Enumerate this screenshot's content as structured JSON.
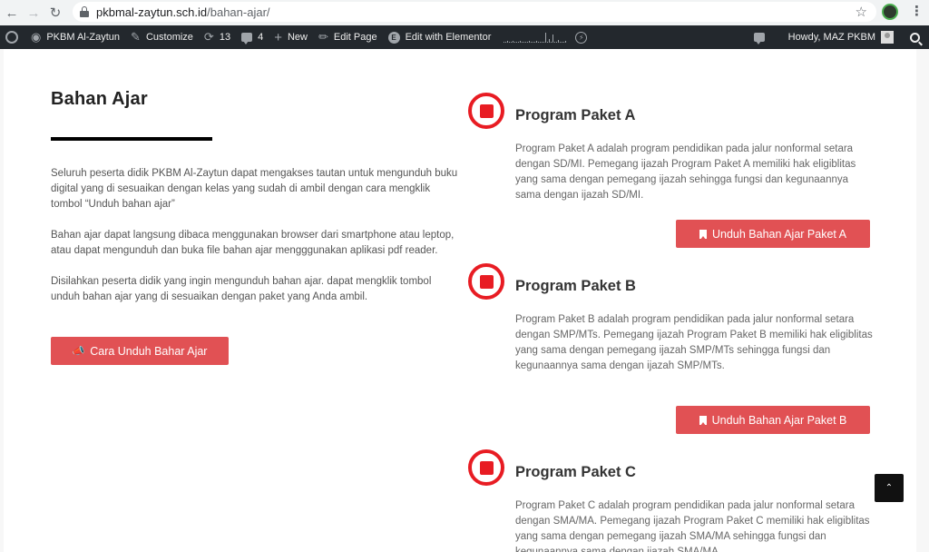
{
  "browser": {
    "url_host": "pkbmal-zaytun.sch.id",
    "url_path": "/bahan-ajar/"
  },
  "adminbar": {
    "site_name": "PKBM Al-Zaytun",
    "customize": "Customize",
    "updates_count": "13",
    "comments_count": "4",
    "new_label": "New",
    "edit_page": "Edit Page",
    "edit_elementor": "Edit with Elementor",
    "howdy": "Howdy, MAZ PKBM"
  },
  "left": {
    "title": "Bahan Ajar",
    "paragraphs": [
      "Seluruh peserta didik PKBM Al-Zaytun dapat mengakses tautan untuk mengunduh buku digital yang di sesuaikan dengan kelas yang sudah di ambil dengan cara mengklik tombol “Unduh bahan ajar”",
      "Bahan ajar dapat langsung dibaca menggunakan browser dari smartphone atau leptop, atau dapat mengunduh dan buka file bahan ajar mengggunakan aplikasi pdf reader.",
      "Disilahkan peserta didik yang ingin mengunduh bahan ajar. dapat mengklik tombol unduh bahan ajar yang di sesuaikan dengan paket yang Anda ambil."
    ],
    "button": "Cara Unduh Bahar Ajar"
  },
  "programs": [
    {
      "title": "Program Paket A",
      "desc": "Program Paket A adalah program pendidikan pada jalur nonformal setara dengan SD/MI. Pemegang ijazah Program Paket A memiliki hak eligiblitas yang sama dengan pemegang ijazah sehingga fungsi dan kegunaannya sama dengan ijazah SD/MI.",
      "button": "Unduh Bahan Ajar Paket A"
    },
    {
      "title": "Program Paket B",
      "desc": "Program Paket B adalah program pendidikan pada jalur nonformal setara dengan SMP/MTs. Pemegang ijazah Program Paket B memiliki hak eligiblitas yang sama dengan pemegang ijazah SMP/MTs sehingga fungsi dan kegunaannya sama dengan ijazah SMP/MTs.",
      "button": "Unduh Bahan Ajar Paket B"
    },
    {
      "title": "Program Paket C",
      "desc": "Program Paket C adalah program pendidikan pada jalur nonformal setara dengan SMA/MA. Pemegang ijazah Program Paket C memiliki hak eligiblitas yang sama dengan pemegang ijazah SMA/MA sehingga fungsi dan kegunaannya sama dengan ijazah SMA/MA."
    }
  ],
  "colors": {
    "accent_button": "#e15154",
    "icon_red": "#e81c23",
    "adminbar_bg": "#23282d"
  },
  "icons": [
    "back-arrow-icon",
    "forward-arrow-icon",
    "reload-icon",
    "lock-icon",
    "star-icon",
    "wordpress-logo-icon",
    "dashboard-icon",
    "brush-icon",
    "updates-icon",
    "comment-icon",
    "plus-icon",
    "pencil-icon",
    "elementor-icon",
    "flash-icon",
    "avatar-icon",
    "search-icon",
    "megaphone-icon",
    "bookmark-icon",
    "stop-circle-icon",
    "chevron-up-icon"
  ]
}
